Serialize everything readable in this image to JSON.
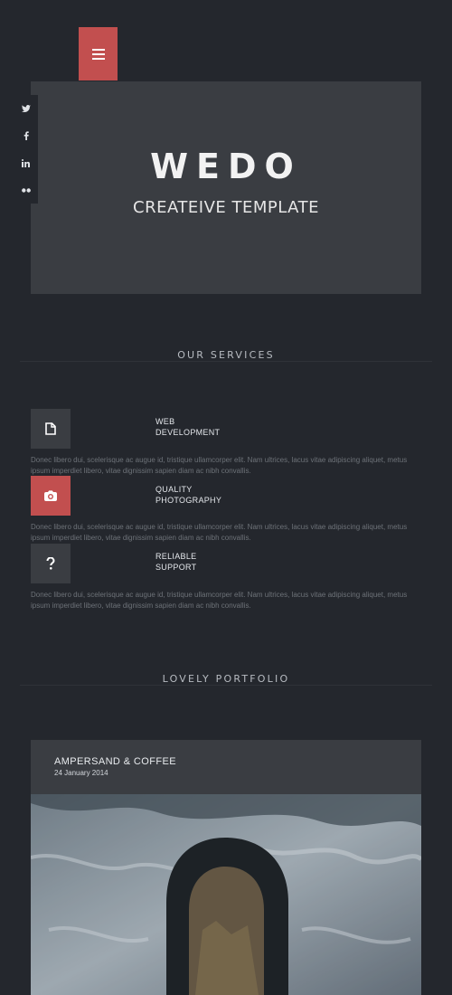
{
  "header": {
    "menu_icon": "menu-icon"
  },
  "social": {
    "items": [
      {
        "label": "twitter",
        "icon": "twitter-icon"
      },
      {
        "label": "facebook",
        "icon": "facebook-icon"
      },
      {
        "label": "linkedin",
        "icon": "linkedin-icon"
      },
      {
        "label": "flickr",
        "icon": "flickr-icon"
      }
    ]
  },
  "hero": {
    "title": "WEDO",
    "subtitle": "CREATEIVE TEMPLATE"
  },
  "services": {
    "heading": "OUR SERVICES",
    "items": [
      {
        "line1": "WEB",
        "line2": "DEVELOPMENT",
        "icon": "document-icon",
        "description": "Donec libero dui, scelerisque ac augue id, tristique ullamcorper elit. Nam ultrices, lacus vitae adipiscing aliquet, metus ipsum imperdiet libero, vitae dignissim sapien diam ac nibh convallis."
      },
      {
        "line1": "QUALITY",
        "line2": "PHOTOGRAPHY",
        "icon": "camera-icon",
        "description": "Donec libero dui, scelerisque ac augue id, tristique ullamcorper elit. Nam ultrices, lacus vitae adipiscing aliquet, metus ipsum imperdiet libero, vitae dignissim sapien diam ac nibh convallis."
      },
      {
        "line1": "RELIABLE",
        "line2": "SUPPORT",
        "icon": "question-icon",
        "description": "Donec libero dui, scelerisque ac augue id, tristique ullamcorper elit. Nam ultrices, lacus vitae adipiscing aliquet, metus ipsum imperdiet libero, vitae dignissim sapien diam ac nibh convallis."
      }
    ]
  },
  "portfolio": {
    "heading": "LOVELY PORTFOLIO",
    "item": {
      "title": "AMPERSAND & COFFEE",
      "date": "24 January 2014"
    }
  },
  "colors": {
    "background": "#24272d",
    "panel": "#3a3d42",
    "accent": "#c24f4f"
  }
}
